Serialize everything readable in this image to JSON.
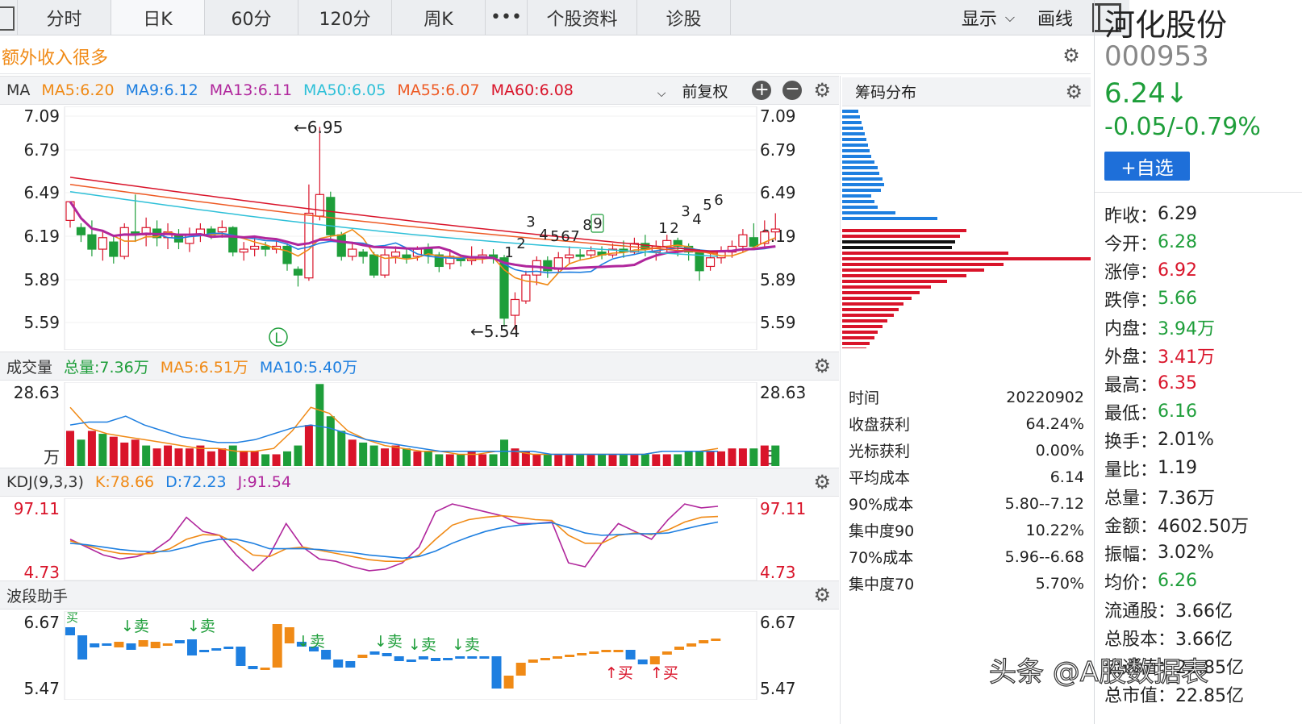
{
  "tabs": [
    {
      "label": "分时",
      "w": 116
    },
    {
      "label": "日K",
      "w": 116,
      "active": true
    },
    {
      "label": "60分",
      "w": 116
    },
    {
      "label": "120分",
      "w": 116
    },
    {
      "label": "周K",
      "w": 116
    },
    {
      "label": "•••",
      "w": 52
    },
    {
      "label": "个股资料",
      "w": 136
    },
    {
      "label": "诊股",
      "w": 116
    }
  ],
  "toolbar": {
    "display_label": "显示",
    "draw_label": "画线"
  },
  "banner": {
    "text": "额外收入很多"
  },
  "ma_header": {
    "title": "MA",
    "items": [
      {
        "label": "MA5:6.20",
        "color": "#f08a16"
      },
      {
        "label": "MA9:6.12",
        "color": "#1e7fe0"
      },
      {
        "label": "MA13:6.11",
        "color": "#b0269c"
      },
      {
        "label": "MA50:6.05",
        "color": "#2fc0d8"
      },
      {
        "label": "MA55:6.07",
        "color": "#ee5a24"
      },
      {
        "label": "MA60:6.08",
        "color": "#d9142a"
      }
    ],
    "adjust_label": "前复权"
  },
  "kline": {
    "y_ticks": [
      "7.09",
      "6.79",
      "6.49",
      "6.19",
      "5.89",
      "5.59"
    ],
    "high_label": "←6.95",
    "low_label": "←5.54",
    "marker_L": "L",
    "seq_labels": [
      "3",
      "4",
      "5",
      "6",
      "7",
      "8",
      "9",
      "1",
      "2",
      "1",
      "2",
      "3",
      "4",
      "5",
      "6"
    ]
  },
  "volume": {
    "title": "成交量",
    "items": [
      {
        "label": "总量:7.36万",
        "color": "#1e9e3a"
      },
      {
        "label": "MA5:6.51万",
        "color": "#f08a16"
      },
      {
        "label": "MA10:5.40万",
        "color": "#1e7fe0"
      }
    ],
    "top": "28.63",
    "unit": "万"
  },
  "kdj": {
    "title": "KDJ(9,3,3)",
    "items": [
      {
        "label": "K:78.66",
        "color": "#f08a16"
      },
      {
        "label": "D:72.23",
        "color": "#1e7fe0"
      },
      {
        "label": "J:91.54",
        "color": "#b0269c"
      }
    ],
    "top": "97.11",
    "bottom": "4.73"
  },
  "wave": {
    "title": "波段助手",
    "top": "6.67",
    "bottom": "5.47",
    "sell": "↓卖",
    "buy": "↑买",
    "buy_word": "买"
  },
  "chip": {
    "title": "筹码分布",
    "rows": [
      {
        "k": "时间",
        "v": "20220902"
      },
      {
        "k": "收盘获利",
        "v": "64.24%"
      },
      {
        "k": "光标获利",
        "v": "0.00%"
      },
      {
        "k": "平均成本",
        "v": "6.14"
      },
      {
        "k": "90%成本",
        "v": "5.80--7.12"
      },
      {
        "k": "集中度90",
        "v": "10.22%"
      },
      {
        "k": "70%成本",
        "v": "5.96--6.68"
      },
      {
        "k": "集中度70",
        "v": "5.70%"
      }
    ]
  },
  "stock": {
    "name": "河化股份",
    "code": "000953",
    "price": "6.24↓",
    "change": "-0.05/-0.79%",
    "add_label": "+自选",
    "info": [
      {
        "k": "昨收：",
        "v": "6.29",
        "color": "#222"
      },
      {
        "k": "今开：",
        "v": "6.28",
        "color": "#1e9e3a"
      },
      {
        "k": "涨停：",
        "v": "6.92",
        "color": "#d9142a"
      },
      {
        "k": "跌停：",
        "v": "5.66",
        "color": "#1e9e3a"
      },
      {
        "k": "内盘：",
        "v": "3.94万",
        "color": "#1e9e3a"
      },
      {
        "k": "外盘：",
        "v": "3.41万",
        "color": "#d9142a"
      },
      {
        "k": "最高：",
        "v": "6.35",
        "color": "#d9142a"
      },
      {
        "k": "最低：",
        "v": "6.16",
        "color": "#1e9e3a"
      },
      {
        "k": "换手：",
        "v": "2.01%",
        "color": "#222"
      },
      {
        "k": "量比：",
        "v": "1.19",
        "color": "#222"
      },
      {
        "k": "总量：",
        "v": "7.36万",
        "color": "#222"
      },
      {
        "k": "金额：",
        "v": "4602.50万",
        "color": "#222"
      },
      {
        "k": "振幅：",
        "v": "3.02%",
        "color": "#222"
      },
      {
        "k": "均价：",
        "v": "6.26",
        "color": "#1e9e3a"
      },
      {
        "k": "流通股：",
        "v": "3.66亿",
        "color": "#222"
      },
      {
        "k": "总股本：",
        "v": "3.66亿",
        "color": "#222"
      },
      {
        "k": "流通值：",
        "v": "22.85亿",
        "color": "#222"
      },
      {
        "k": "总市值：",
        "v": "22.85亿",
        "color": "#222"
      }
    ]
  },
  "watermark": "头条 @A股数据表",
  "colors": {
    "up": "#d9142a",
    "down": "#1e9e3a",
    "blue": "#1e7fe0",
    "orange": "#f08a16",
    "purple": "#b0269c"
  }
}
